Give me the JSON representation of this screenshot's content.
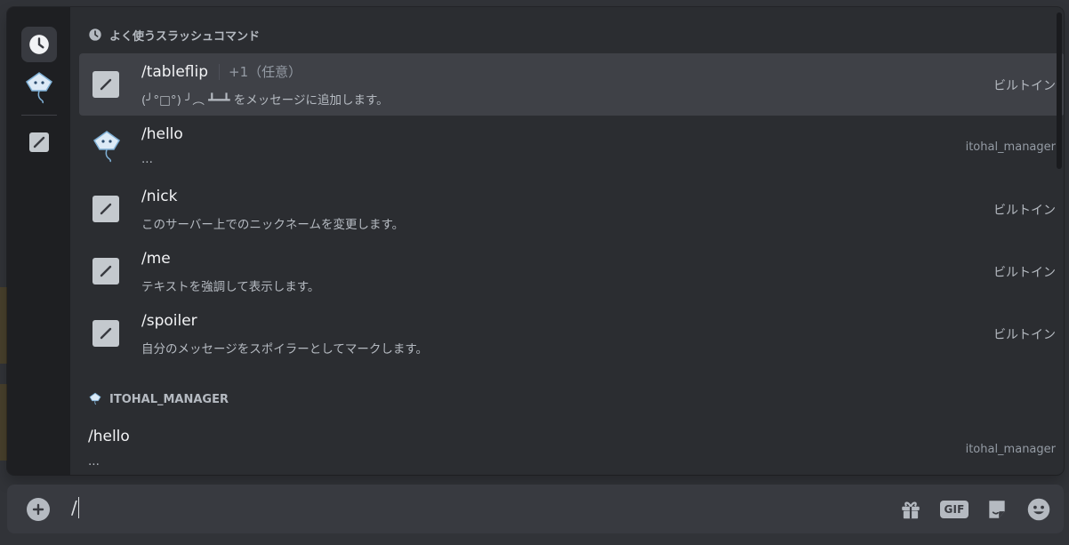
{
  "popup": {
    "recent_section_title": "よく使うスラッシュコマンド",
    "recent_commands": [
      {
        "name": "/tableflip",
        "option": "+1（任意）",
        "description": "(╯°□°) ╯︵ ┻━┻ をメッセージに追加します。",
        "source": "ビルトイン",
        "icon": "slash-command-icon"
      },
      {
        "name": "/hello",
        "option": "",
        "description": "...",
        "source": "itohal_manager",
        "icon": "bot-avatar-icon"
      },
      {
        "name": "/nick",
        "option": "",
        "description": "このサーバー上でのニックネームを変更します。",
        "source": "ビルトイン",
        "icon": "slash-command-icon"
      },
      {
        "name": "/me",
        "option": "",
        "description": "テキストを強調して表示します。",
        "source": "ビルトイン",
        "icon": "slash-command-icon"
      },
      {
        "name": "/spoiler",
        "option": "",
        "description": "自分のメッセージをスポイラーとしてマークします。",
        "source": "ビルトイン",
        "icon": "slash-command-icon"
      }
    ],
    "app_section_title": "ITOHAL_MANAGER",
    "app_commands": [
      {
        "name": "/hello",
        "description": "...",
        "source": "itohal_manager"
      }
    ]
  },
  "rail": {
    "icons": [
      "clock-icon",
      "bot-avatar-icon",
      "slash-command-icon"
    ]
  },
  "composer": {
    "input_value": "/",
    "icons": [
      "add-icon",
      "gift-icon",
      "gif-icon",
      "sticker-icon",
      "emoji-icon"
    ],
    "gif_label": "GIF"
  },
  "colors": {
    "background": "#313338",
    "popup": "#2b2d31",
    "rail": "#1e1f22",
    "selected": "#3f4147",
    "composer": "#383a40"
  }
}
